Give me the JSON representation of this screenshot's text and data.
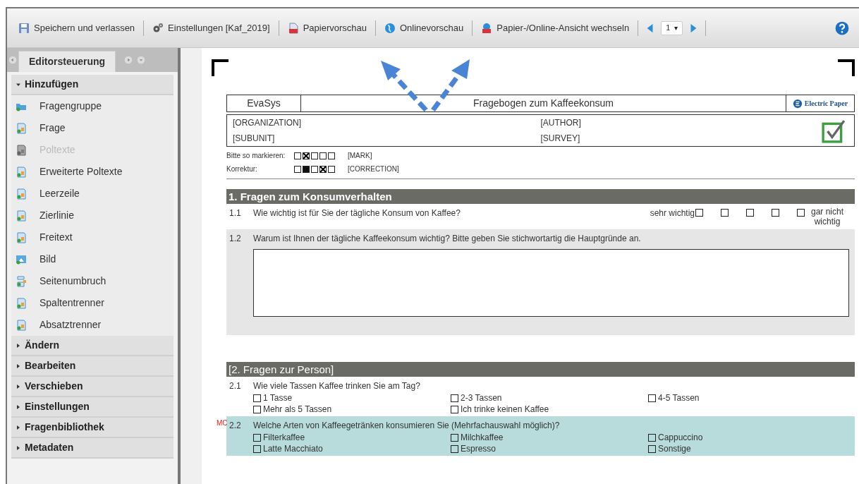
{
  "toolbar": {
    "items": [
      {
        "kind": "save",
        "label": "Speichern und verlassen"
      },
      {
        "kind": "settings",
        "label": "Einstellungen [Kaf_2019]"
      },
      {
        "kind": "pdf",
        "label": "Papiervorschau"
      },
      {
        "kind": "globe",
        "label": "Onlinevorschau"
      },
      {
        "kind": "switch",
        "label": "Papier-/Online-Ansicht wechseln"
      }
    ],
    "page_select": {
      "value": "1",
      "arrow": "▾"
    }
  },
  "sidebar": {
    "tab": "Editorsteuerung",
    "sections": [
      {
        "label": "Hinzufügen",
        "expanded": true,
        "items": [
          {
            "label": "Fragengruppe",
            "kind": "folder",
            "disabled": false
          },
          {
            "label": "Frage",
            "kind": "doc",
            "disabled": false
          },
          {
            "label": "Poltexte",
            "kind": "doc",
            "disabled": true
          },
          {
            "label": "Erweiterte Poltexte",
            "kind": "doc",
            "disabled": false
          },
          {
            "label": "Leerzeile",
            "kind": "doc",
            "disabled": false
          },
          {
            "label": "Zierlinie",
            "kind": "doc",
            "disabled": false
          },
          {
            "label": "Freitext",
            "kind": "doc",
            "disabled": false
          },
          {
            "label": "Bild",
            "kind": "image",
            "disabled": false
          },
          {
            "label": "Seitenumbruch",
            "kind": "break",
            "disabled": false
          },
          {
            "label": "Spaltentrenner",
            "kind": "doc",
            "disabled": false
          },
          {
            "label": "Absatztrenner",
            "kind": "doc",
            "disabled": false
          }
        ]
      },
      {
        "label": "Ändern",
        "expanded": false
      },
      {
        "label": "Bearbeiten",
        "expanded": false
      },
      {
        "label": "Verschieben",
        "expanded": false
      },
      {
        "label": "Einstellungen",
        "expanded": false
      },
      {
        "label": "Fragenbibliothek",
        "expanded": false
      },
      {
        "label": "Metadaten",
        "expanded": false
      }
    ]
  },
  "document": {
    "header": {
      "left": "EvaSys",
      "title": "Fragebogen zum Kaffeekonsum",
      "logo": "Electric Paper"
    },
    "fields": [
      "[ORGANIZATION]",
      "[AUTHOR]",
      "[SUBUNIT]",
      "[SURVEY]"
    ],
    "legend": [
      {
        "label": "Bitte so markieren:",
        "boxes": [
          {
            "checked": false
          },
          {
            "checked": true,
            "kind": "cross"
          },
          {
            "checked": false
          },
          {
            "checked": false
          },
          {
            "checked": false
          }
        ],
        "placeholder": "[MARK]"
      },
      {
        "label": "Korrektur:",
        "boxes": [
          {
            "checked": false
          },
          {
            "checked": true,
            "kind": "fill"
          },
          {
            "checked": false
          },
          {
            "checked": true,
            "kind": "cross"
          },
          {
            "checked": false
          }
        ],
        "placeholder": "[CORRECTION]"
      }
    ],
    "sections": [
      {
        "title": "1. Fragen zum Konsumverhalten",
        "questions": [
          {
            "kind": "scale",
            "number": "1.1",
            "text": "Wie wichtig ist für Sie der tägliche Konsum von Kaffee?",
            "left": "sehr wichtig",
            "right": "gar nicht wichtig",
            "boxes": [
              {
                "checked": false
              },
              {
                "checked": false
              },
              {
                "checked": false
              },
              {
                "checked": false
              },
              {
                "checked": false
              }
            ]
          },
          {
            "kind": "text",
            "number": "1.2",
            "text": "Warum ist Ihnen der tägliche Kaffeekonsum wichtig? Bitte geben Sie stichwortartig die Hauptgründe an."
          }
        ]
      },
      {
        "title": "[2. Fragen zur Person]",
        "questions": [
          {
            "kind": "choice",
            "number": "2.1",
            "text": "Wie viele Tassen Kaffee trinken Sie am Tag?",
            "highlighted": false,
            "options": [
              {
                "label": "1 Tasse",
                "checked": false
              },
              {
                "label": "2-3 Tassen",
                "checked": false
              },
              {
                "label": "4-5 Tassen",
                "checked": false
              },
              {
                "label": "Mehr als 5 Tassen",
                "checked": false
              },
              {
                "label": "Ich trinke keinen Kaffee",
                "checked": false
              }
            ]
          },
          {
            "kind": "choice",
            "number": "2.2",
            "marker": "MC",
            "text": "Welche Arten von Kaffeegetränken konsumieren Sie (Mehrfachauswahl möglich)?",
            "highlighted": true,
            "options": [
              {
                "label": "Filterkaffee",
                "checked": false
              },
              {
                "label": "Milchkaffee",
                "checked": false
              },
              {
                "label": "Cappuccino",
                "checked": false
              },
              {
                "label": "Latte Macchiato",
                "checked": false
              },
              {
                "label": "Espresso",
                "checked": false
              },
              {
                "label": "Sonstige",
                "checked": false
              }
            ]
          }
        ]
      }
    ]
  }
}
